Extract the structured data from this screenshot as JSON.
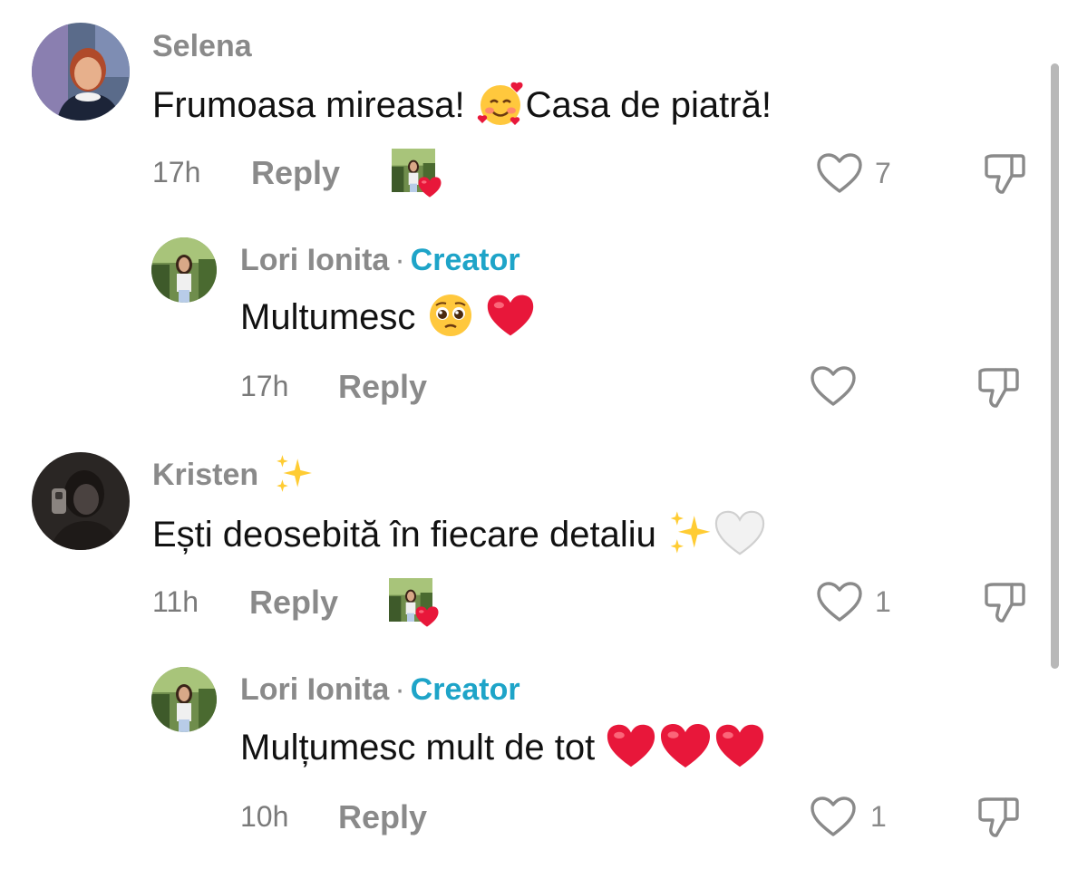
{
  "comments": [
    {
      "name": "Selena",
      "text_before": "Frumoasa mireasa! ",
      "text_after": "Casa de piatră!",
      "time": "17h",
      "reply": "Reply",
      "likes": "7"
    },
    {
      "name": "Lori Ionita",
      "dot": "·",
      "badge": "Creator",
      "text": "Multumesc ",
      "time": "17h",
      "reply": "Reply"
    },
    {
      "name": "Kristen",
      "text": "Ești deosebită în fiecare detaliu ",
      "time": "11h",
      "reply": "Reply",
      "likes": "1"
    },
    {
      "name": "Lori Ionita",
      "dot": "·",
      "badge": "Creator",
      "text": "Mulțumesc mult de tot ",
      "time": "10h",
      "reply": "Reply",
      "likes": "1"
    }
  ],
  "colors": {
    "creator_badge": "#1ea4c8",
    "username": "#8a8a8a",
    "heart_red": "#e8173a"
  },
  "icons": [
    "heart-outline-icon",
    "thumbs-down-icon",
    "creator-liked-badge-icon",
    "smiling-hearts-emoji",
    "pleading-face-emoji",
    "red-heart-emoji",
    "sparkles-emoji",
    "white-heart-emoji"
  ]
}
